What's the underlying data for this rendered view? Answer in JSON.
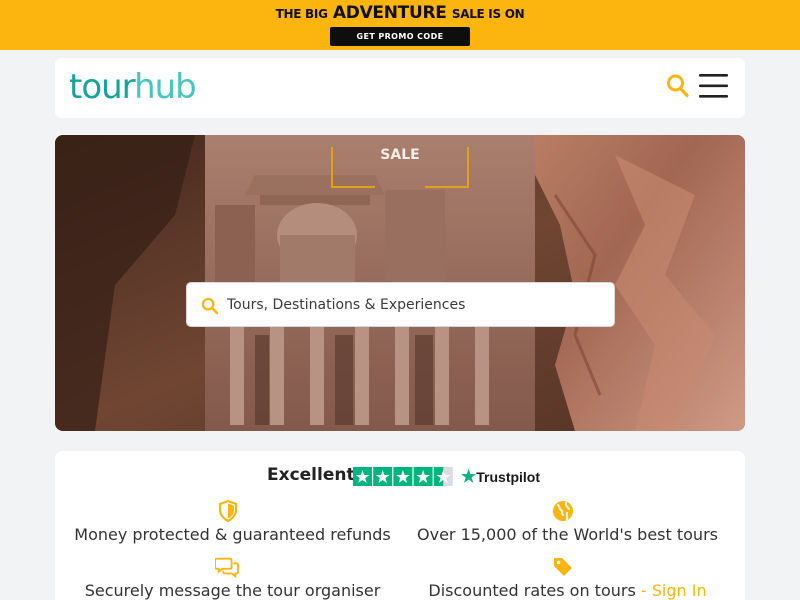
{
  "promo": {
    "title_prefix": "THE BIG",
    "title_highlight": "ADVENTURE",
    "title_suffix": "SALE IS ON",
    "button_label": "GET PROMO CODE"
  },
  "header": {
    "logo_part1": "tour",
    "logo_part2": "hub",
    "search_icon": "search-icon",
    "menu_icon": "hamburger-menu-icon"
  },
  "hero": {
    "sale_label": "SALE",
    "search_placeholder": "Tours, Destinations & Experiences"
  },
  "trust": {
    "rating_label": "Excellent",
    "stars": 4.5,
    "trustpilot_label": "Trustpilot",
    "features": [
      {
        "icon": "shield-icon",
        "text": "Money protected & guaranteed refunds"
      },
      {
        "icon": "globe-icon",
        "text": "Over 15,000 of the World's best tours"
      },
      {
        "icon": "chat-bubbles-icon",
        "text": "Securely message the tour organiser"
      },
      {
        "icon": "price-tag-icon",
        "text": "Discounted rates on tours",
        "link": "- Sign In"
      }
    ]
  },
  "colors": {
    "accent": "#fbb50e",
    "brand_teal": "#14a49b",
    "brand_teal_light": "#49c5bd",
    "trustpilot_green": "#00b67a"
  }
}
